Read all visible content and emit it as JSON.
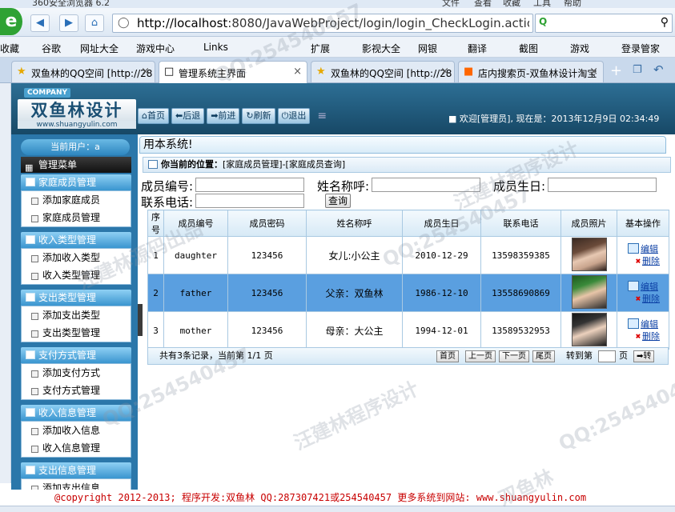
{
  "browser": {
    "window_title": "360安全浏览器 6.2",
    "menus": [
      "文件",
      "查看",
      "收藏",
      "工具",
      "帮助"
    ],
    "url_host": "http://localhost",
    "url_rest": ":8080/JavaWebProject/login/login_CheckLogin.actio",
    "bookmarks": [
      "收藏",
      "谷歌",
      "网址大全",
      "游戏中心",
      "Links",
      "扩展",
      "影视大全",
      "网银",
      "翻译",
      "截图",
      "游戏",
      "登录管家"
    ],
    "tabs": [
      {
        "label": "双鱼林的QQ空间 [http://28",
        "active": false
      },
      {
        "label": "管理系统主界面",
        "active": true
      },
      {
        "label": "双鱼林的QQ空间 [http://28",
        "active": false
      },
      {
        "label": "店内搜索页-双鱼林设计淘宝",
        "active": false
      }
    ]
  },
  "header": {
    "company": "COMPANY",
    "brand": "双鱼林设计",
    "brand_url": "www.shuangyulin.com",
    "nav": [
      "首页",
      "后退",
      "前进",
      "刷新",
      "退出"
    ],
    "welcome": "欢迎[管理员],  现在是：2013年12月9日  02:34:49"
  },
  "sidebar": {
    "current_user": "当前用户：a",
    "main_menu": "管理菜单",
    "sections": [
      {
        "title": "家庭成员管理",
        "items": [
          "添加家庭成员",
          "家庭成员管理"
        ]
      },
      {
        "title": "收入类型管理",
        "items": [
          "添加收入类型",
          "收入类型管理"
        ]
      },
      {
        "title": "支出类型管理",
        "items": [
          "添加支出类型",
          "支出类型管理"
        ]
      },
      {
        "title": "支付方式管理",
        "items": [
          "添加支付方式",
          "支付方式管理"
        ]
      },
      {
        "title": "收入信息管理",
        "items": [
          "添加收入信息",
          "收入信息管理"
        ]
      },
      {
        "title": "支出信息管理",
        "items": [
          "添加支出信息"
        ]
      }
    ]
  },
  "main": {
    "system_bar": "用本系统!",
    "location_label": "你当前的位置：",
    "location_path": "[家庭成员管理]-[家庭成员查询]",
    "search": {
      "member_no_label": "成员编号:",
      "name_label": "姓名称呼:",
      "birthday_label": "成员生日:",
      "phone_label": "联系电话:",
      "query_button": "查询"
    },
    "table": {
      "headers": [
        "序号",
        "成员编号",
        "成员密码",
        "姓名称呼",
        "成员生日",
        "联系电话",
        "成员照片",
        "基本操作"
      ],
      "rows": [
        {
          "no": "1",
          "member_no": "daughter",
          "password": "123456",
          "name": "女儿:小公主",
          "birthday": "2010-12-29",
          "phone": "13598359385"
        },
        {
          "no": "2",
          "member_no": "father",
          "password": "123456",
          "name": "父亲：双鱼林",
          "birthday": "1986-12-10",
          "phone": "13558690869"
        },
        {
          "no": "3",
          "member_no": "mother",
          "password": "123456",
          "name": "母亲：大公主",
          "birthday": "1994-12-01",
          "phone": "13589532953"
        }
      ],
      "edit_label": "编辑",
      "delete_label": "删除"
    },
    "pager": {
      "summary": "共有3条记录，当前第 1/1 页",
      "first": "首页",
      "prev": "上一页",
      "next": "下一页",
      "last": "尾页",
      "goto_label": "转到第",
      "page_suffix": "页",
      "go_button": "转"
    }
  },
  "footer": {
    "text": "@copyright 2012-2013; 程序开发:双鱼林  QQ:287307421或254540457  更多系统到网站: www.shuangyulin.com"
  },
  "watermarks": [
    "QQ:254540457",
    "汪建林程序设计",
    "汪建林源码出品",
    "双鱼林"
  ]
}
